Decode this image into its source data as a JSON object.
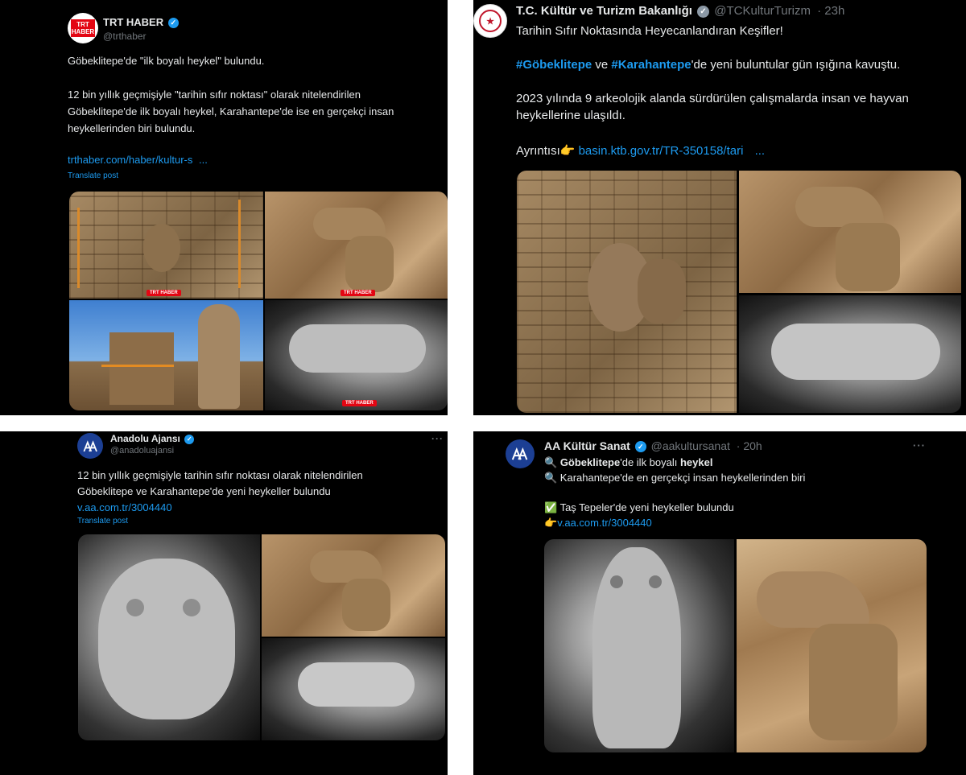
{
  "tweets": [
    {
      "name": "TRT HABER",
      "handle": "@trthaber",
      "lines": [
        "Göbeklitepe'de \"ilk boyalı heykel\" bulundu.",
        "12 bin yıllık geçmişiyle \"tarihin sıfır noktası\" olarak nitelendirilen",
        "Göbeklitepe'de ilk boyalı heykel, Karahantepe'de ise en gerçekçi insan",
        "heykellerinden biri bulundu."
      ],
      "link": "trthaber.com/haber/kultur-s",
      "link_ellipsis": "...",
      "translate": "Translate post",
      "logo_text": [
        "TRT",
        "HABER"
      ],
      "watermark": "TRT HABER"
    },
    {
      "name": "T.C. Kültür ve Turizm Bakanlığı",
      "handle": "@TCKulturTurizm",
      "time": "· 23h",
      "line1": "Tarihin Sıfır Noktasında Heyecanlandıran Keşifler!",
      "tag1": "#Göbeklitepe",
      "and": " ve ",
      "tag2": "#Karahantepe",
      "line2_rest": "'de yeni buluntular gün ışığına kavuştu.",
      "line3": "2023 yılında 9 arkeolojik alanda sürdürülen çalışmalarda insan ve hayvan",
      "line4": "heykellerine ulaşıldı.",
      "detail_label": "Ayrıntısı👉",
      "link": "basin.ktb.gov.tr/TR-350158/tari",
      "link_ellipsis": "..."
    },
    {
      "name": "Anadolu Ajansı",
      "handle": "@anadoluajansi",
      "more": "···",
      "lines": [
        "12 bin yıllık geçmişiyle tarihin sıfır noktası olarak nitelendirilen",
        "Göbeklitepe ve Karahantepe'de yeni heykeller bulundu"
      ],
      "link": "v.aa.com.tr/3004440",
      "translate": "Translate post"
    },
    {
      "name": "AA Kültür Sanat",
      "handle": "@aakultursanat",
      "time": "· 20h",
      "more": "···",
      "line1_icon": "🔍",
      "line1_bold": "Göbeklitepe",
      "line1_mid": "'de ilk boyalı ",
      "line1_bold2": "heykel",
      "line2": "🔍 Karahantepe'de en gerçekçi insan heykellerinden biri",
      "line3": "✅ Taş Tepeler'de yeni heykeller bulundu",
      "link_prefix": "👉",
      "link": "v.aa.com.tr/3004440"
    }
  ]
}
